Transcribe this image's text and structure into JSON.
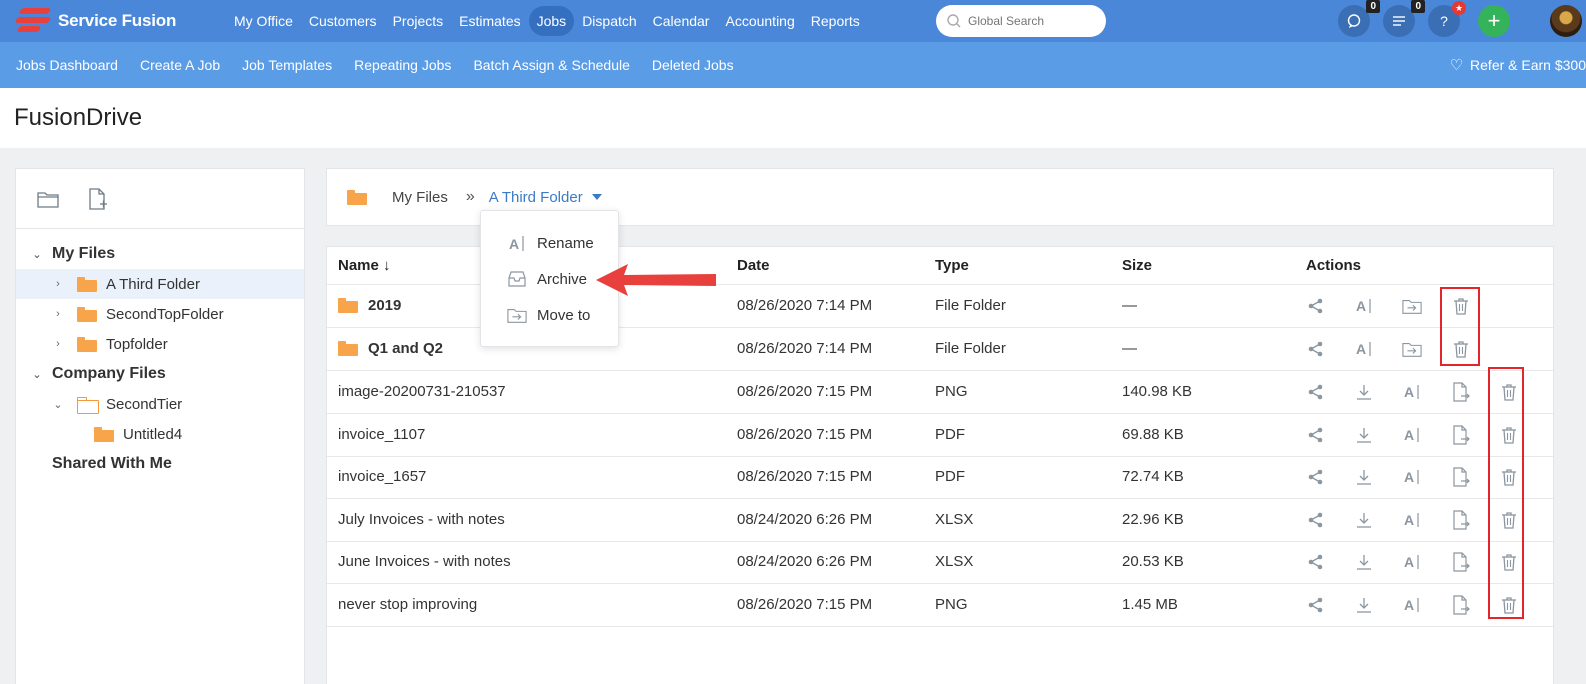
{
  "brand": {
    "name": "Service Fusion"
  },
  "nav": {
    "items": [
      {
        "label": "My Office",
        "active": false
      },
      {
        "label": "Customers",
        "active": false
      },
      {
        "label": "Projects",
        "active": false
      },
      {
        "label": "Estimates",
        "active": false
      },
      {
        "label": "Jobs",
        "active": true
      },
      {
        "label": "Dispatch",
        "active": false
      },
      {
        "label": "Calendar",
        "active": false
      },
      {
        "label": "Accounting",
        "active": false
      },
      {
        "label": "Reports",
        "active": false
      }
    ],
    "search_placeholder": "Global Search",
    "chat_count": "0",
    "tasks_count": "0",
    "help_label": "?",
    "add_label": "+"
  },
  "subnav": {
    "items": [
      "Jobs Dashboard",
      "Create A Job",
      "Job Templates",
      "Repeating Jobs",
      "Batch Assign & Schedule",
      "Deleted Jobs"
    ],
    "refer": "Refer & Earn $300"
  },
  "page": {
    "title": "FusionDrive"
  },
  "tree": {
    "my_files": "My Files",
    "children": [
      "A Third Folder",
      "SecondTopFolder",
      "Topfolder"
    ],
    "company_files": "Company Files",
    "second_tier": "SecondTier",
    "untitled": "Untitled4",
    "shared": "Shared With Me"
  },
  "breadcrumb": {
    "root": "My Files",
    "separator": "»",
    "current": "A Third Folder"
  },
  "menu": {
    "items": [
      "Rename",
      "Archive",
      "Move to"
    ]
  },
  "table": {
    "headers": {
      "name": "Name",
      "sort_icon": "↓",
      "date": "Date",
      "type": "Type",
      "size": "Size",
      "actions": "Actions"
    },
    "folders": [
      {
        "name": "2019",
        "date": "08/26/2020 7:14 PM",
        "type": "File Folder",
        "size": "—"
      },
      {
        "name": "Q1 and Q2",
        "date": "08/26/2020 7:14 PM",
        "type": "File Folder",
        "size": "—"
      }
    ],
    "files": [
      {
        "name": "image-20200731-210537",
        "date": "08/26/2020 7:15 PM",
        "type": "PNG",
        "size": "140.98 KB"
      },
      {
        "name": "invoice_1107",
        "date": "08/26/2020 7:15 PM",
        "type": "PDF",
        "size": "69.88 KB"
      },
      {
        "name": "invoice_1657",
        "date": "08/26/2020 7:15 PM",
        "type": "PDF",
        "size": "72.74 KB"
      },
      {
        "name": "July Invoices - with notes",
        "date": "08/24/2020 6:26 PM",
        "type": "XLSX",
        "size": "22.96 KB"
      },
      {
        "name": "June Invoices - with notes",
        "date": "08/24/2020 6:26 PM",
        "type": "XLSX",
        "size": "20.53 KB"
      },
      {
        "name": "never stop improving",
        "date": "08/26/2020 7:15 PM",
        "type": "PNG",
        "size": "1.45 MB"
      }
    ]
  },
  "colors": {
    "nav": "#4a87d8",
    "subnav": "#5b9ce6",
    "folder": "#f7a44a",
    "highlight": "#e3262a",
    "link": "#3a7bc8"
  }
}
